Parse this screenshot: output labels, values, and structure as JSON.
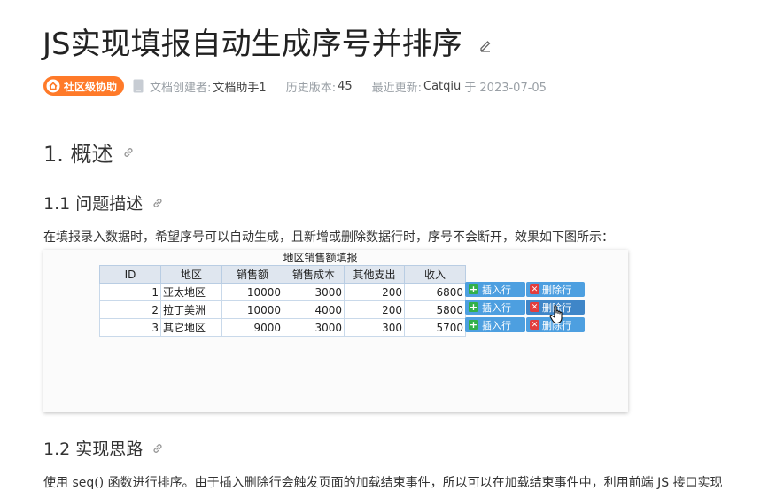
{
  "header": {
    "title": "JS实现填报自动生成序号并排序"
  },
  "meta": {
    "badge": "社区级协助",
    "creator_label": "文档创建者:",
    "creator": "文档助手1",
    "version_label": "历史版本:",
    "version": "45",
    "updated_label": "最近更新:",
    "updated_by": "Catqiu",
    "updated_on": "于 2023-07-05"
  },
  "sections": {
    "h1": "1. 概述",
    "h2_problem": "1.1 问题描述",
    "problem_text": "在填报录入数据时，希望序号可以自动生成，且新增或删除数据行时，序号不会断开，效果如下图所示：",
    "h2_approach": "1.2 实现思路",
    "approach_text": "使用 seq() 函数进行排序。由于插入删除行会触发页面的加载结束事件，所以可以在加载结束事件中，利用前端 JS 接口实现"
  },
  "screenshot": {
    "title": "地区销售额填报",
    "columns": [
      "ID",
      "地区",
      "销售额",
      "销售成本",
      "其他支出",
      "收入"
    ],
    "rows": [
      [
        "1",
        "亚太地区",
        "10000",
        "3000",
        "200",
        "6800"
      ],
      [
        "2",
        "拉丁美洲",
        "10000",
        "4000",
        "200",
        "5800"
      ],
      [
        "3",
        "其它地区",
        "9000",
        "3000",
        "300",
        "5700"
      ]
    ],
    "insert_label": "插入行",
    "delete_label": "删除行",
    "delete_label_last": "删除行"
  },
  "colors": {
    "badge": "#ff7a29",
    "button": "#4d9fe0",
    "plus": "#32b04a",
    "cross": "#e23d3d"
  },
  "icons": [
    "edit-icon",
    "home-icon",
    "document-icon",
    "link-icon",
    "plus-icon",
    "close-icon",
    "hand-cursor-icon"
  ]
}
